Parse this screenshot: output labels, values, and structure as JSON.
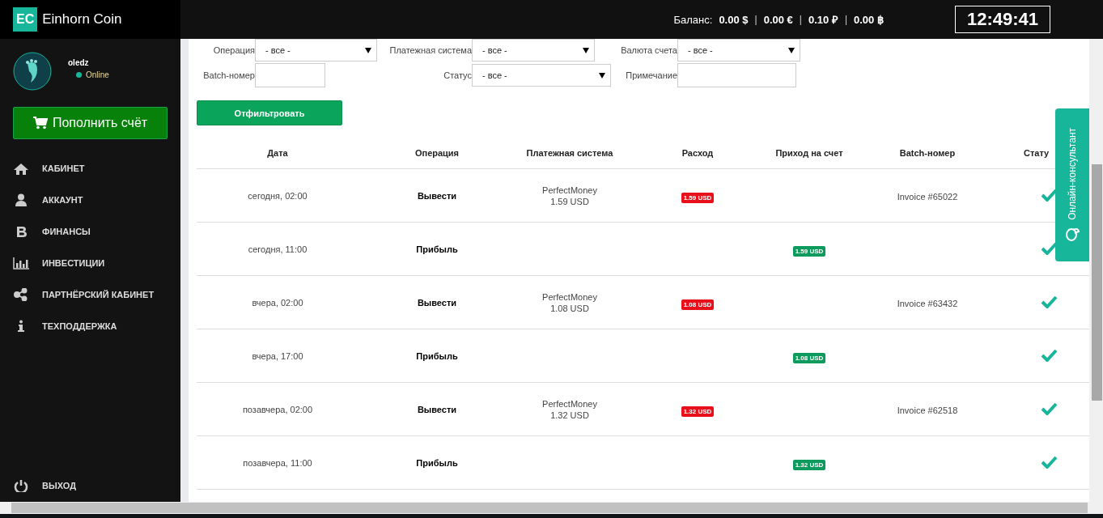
{
  "logo": {
    "badge": "EC",
    "name": "Einhorn Coin"
  },
  "header": {
    "balance_label": "Баланс:",
    "balances": [
      "0.00 $",
      "0.00 €",
      "0.10 ₽",
      "0.00 ฿"
    ],
    "separator": "|",
    "clock": "12:49:41"
  },
  "user": {
    "name": "oledz",
    "status": "Online",
    "online": true
  },
  "topup_button": "Пополнить счёт",
  "sidebar": {
    "items": [
      {
        "label": "КАБИНЕТ"
      },
      {
        "label": "АККАУНТ"
      },
      {
        "label": "ФИНАНСЫ"
      },
      {
        "label": "ИНВЕСТИЦИИ"
      },
      {
        "label": "ПАРТНЁРСКИЙ КАБИНЕТ"
      },
      {
        "label": "ТЕХПОДДЕРЖКА"
      }
    ],
    "logout": {
      "label": "ВЫХОД"
    }
  },
  "filters": [
    {
      "label": "Операция",
      "kind": "select",
      "value": "- все -"
    },
    {
      "label": "Платежная система",
      "kind": "select",
      "value": "- все -"
    },
    {
      "label": "Валюта счета",
      "kind": "select",
      "value": "- все -"
    },
    {
      "label": "Batch-номер",
      "kind": "input"
    },
    {
      "label": "Статус",
      "kind": "select",
      "value": "- все -"
    },
    {
      "label": "Примечание",
      "kind": "input"
    }
  ],
  "filter_button": "Отфильтровать",
  "table": {
    "columns": [
      "Дата",
      "Операция",
      "Платежная система",
      "Расход",
      "Приход на счет",
      "Batch-номер",
      "Стату"
    ],
    "rows": [
      {
        "date": "сегодня, 02:00",
        "operation": "Вывести",
        "system": "PerfectMoney",
        "system_amount": "1.59 USD",
        "expense": "1.59 USD",
        "batch": "Invoice #65022",
        "completed": true
      },
      {
        "date": "сегодня, 11:00",
        "operation": "Прибыль",
        "income": "1.59 USD",
        "completed": true
      },
      {
        "date": "вчера, 02:00",
        "operation": "Вывести",
        "system": "PerfectMoney",
        "system_amount": "1.08 USD",
        "expense": "1.08 USD",
        "batch": "Invoice #63432",
        "completed": true
      },
      {
        "date": "вчера, 17:00",
        "operation": "Прибыль",
        "income": "1.08 USD",
        "completed": true
      },
      {
        "date": "позавчера, 02:00",
        "operation": "Вывести",
        "system": "PerfectMoney",
        "system_amount": "1.32 USD",
        "expense": "1.32 USD",
        "batch": "Invoice #62518",
        "completed": true
      },
      {
        "date": "позавчера, 11:00",
        "operation": "Прибыль",
        "income": "1.32 USD",
        "completed": true
      }
    ]
  },
  "consultant_tab": "Онлайн-консультант"
}
